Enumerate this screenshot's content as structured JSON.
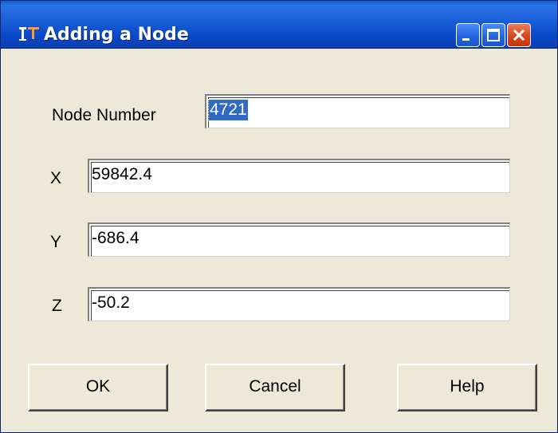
{
  "window": {
    "title": "Adding a Node",
    "icon": "app-icon"
  },
  "titlebar_buttons": {
    "minimize": "minimize-icon",
    "maximize": "maximize-icon",
    "close": "close-icon"
  },
  "form": {
    "node_number_label": "Node Number",
    "node_number_value": "4721",
    "x_label": "X",
    "x_value": "59842.4",
    "y_label": "Y",
    "y_value": "-686.4",
    "z_label": "Z",
    "z_value": "-50.2"
  },
  "buttons": {
    "ok": "OK",
    "cancel": "Cancel",
    "help": "Help"
  },
  "colors": {
    "title_bar": "#0a48c8",
    "window_body": "#ece9d8",
    "selection": "#316ac5",
    "close_button": "#d8481c"
  }
}
